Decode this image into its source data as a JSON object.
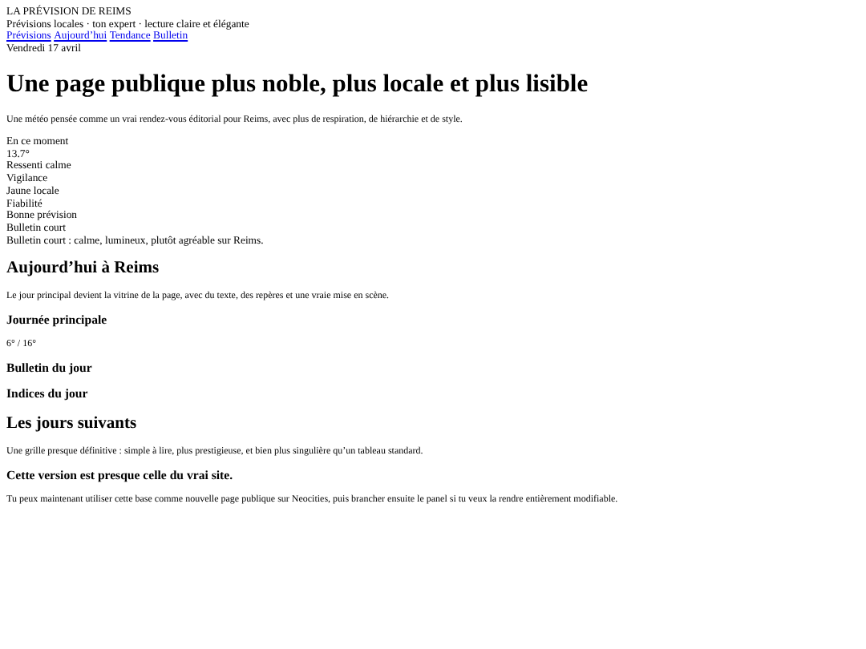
{
  "site": {
    "title": "LA PRÉVISION DE REIMS",
    "tagline": "Prévisions locales · ton expert · lecture claire et élégante",
    "nav": [
      "Prévisions",
      "Aujourd’hui",
      "Tendance",
      "Bulletin"
    ],
    "date": "Vendredi 17 avril"
  },
  "hero": {
    "heading": "Une page publique plus noble, plus locale et plus lisible",
    "intro": "Une météo pensée comme un vrai rendez-vous éditorial pour Reims, avec plus de respiration, de hiérarchie et de style."
  },
  "current": [
    "En ce moment",
    "13.7°",
    "Ressenti calme",
    "Vigilance",
    "Jaune locale",
    "Fiabilité",
    "Bonne prévision",
    "Bulletin court",
    "Bulletin court : calme, lumineux, plutôt agréable sur Reims."
  ],
  "today": {
    "heading": "Aujourd’hui à Reims",
    "intro": "Le jour principal devient la vitrine de la page, avec du texte, des repères et une vraie mise en scène.",
    "blocks": [
      {
        "heading": "Journée principale",
        "text": "6° / 16°"
      },
      {
        "heading": "Bulletin du jour"
      },
      {
        "heading": "Indices du jour"
      }
    ]
  },
  "next": {
    "heading": "Les jours suivants",
    "intro": "Une grille presque définitive : simple à lire, plus prestigieuse, et bien plus singulière qu’un tableau standard."
  },
  "footer": {
    "heading": "Cette version est presque celle du vrai site.",
    "text": "Tu peux maintenant utiliser cette base comme nouvelle page publique sur Neocities, puis brancher ensuite le panel si tu veux la rendre entièrement modifiable."
  }
}
